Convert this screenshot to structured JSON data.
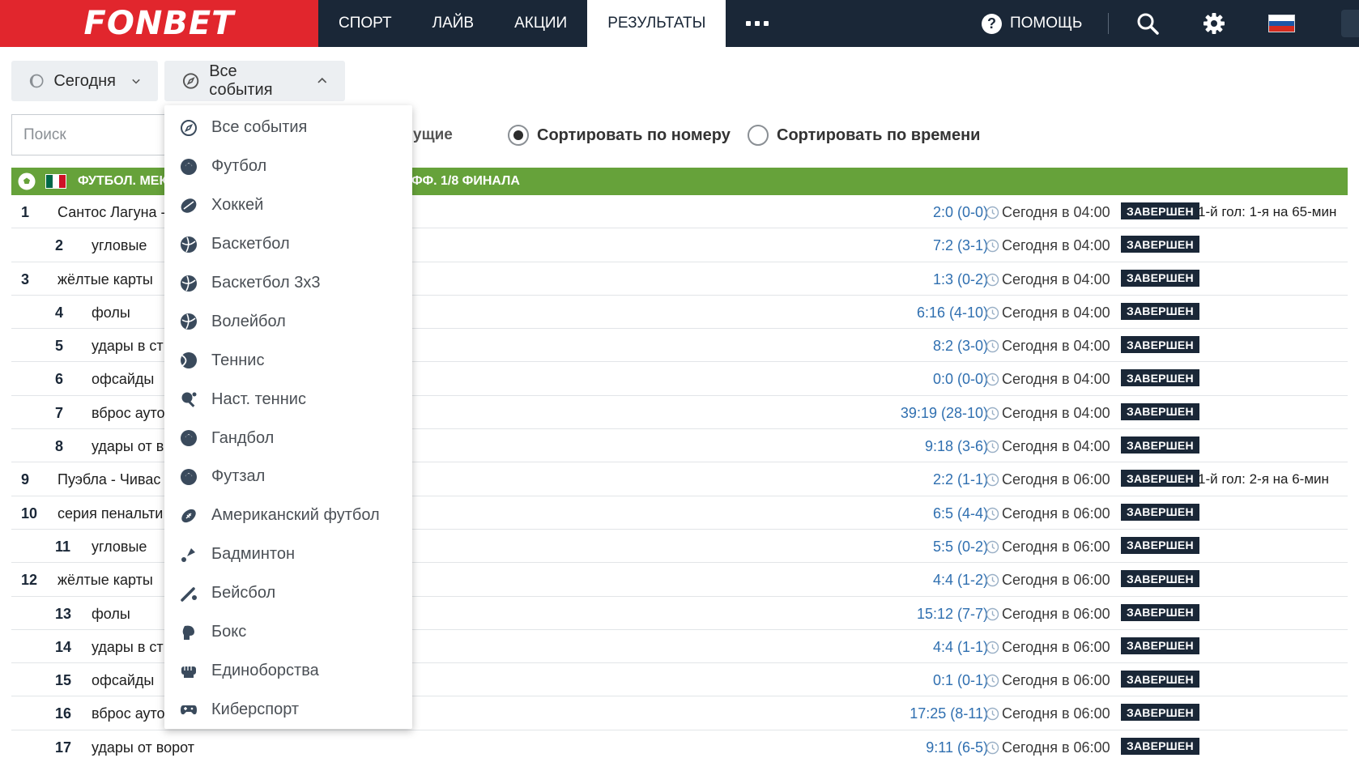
{
  "brand": {
    "logo": "FONBET"
  },
  "nav": {
    "items": [
      {
        "label": "СПОРТ",
        "active": false
      },
      {
        "label": "ЛАЙВ",
        "active": false
      },
      {
        "label": "АКЦИИ",
        "active": false
      },
      {
        "label": "РЕЗУЛЬТАТЫ",
        "active": true
      }
    ],
    "help_label": "ПОМОЩЬ"
  },
  "filters": {
    "date_label": "Сегодня",
    "events_label": "Все события",
    "search_placeholder": "Поиск",
    "partial_label": "ущие",
    "sort_by_number": "Сортировать по номеру",
    "sort_by_time": "Сортировать по времени",
    "sort_selected": "number"
  },
  "league": {
    "name_left": "ФУТБОЛ. МЕК",
    "name_right": "ФФ. 1/8 ФИНАЛА"
  },
  "rows": [
    {
      "num": "1",
      "indent": false,
      "name": "Сантос Лагуна -",
      "score": "2:0 (0-0)",
      "time": "Сегодня в 04:00",
      "status": "ЗАВЕРШЕН",
      "note": "1-й гол: 1-я на 65-мин"
    },
    {
      "num": "2",
      "indent": true,
      "name": "угловые",
      "score": "7:2 (3-1)",
      "time": "Сегодня в 04:00",
      "status": "ЗАВЕРШЕН",
      "note": ""
    },
    {
      "num": "3",
      "indent": false,
      "name": "жёлтые карты",
      "score": "1:3 (0-2)",
      "time": "Сегодня в 04:00",
      "status": "ЗАВЕРШЕН",
      "note": ""
    },
    {
      "num": "4",
      "indent": true,
      "name": "фолы",
      "score": "6:16 (4-10)",
      "time": "Сегодня в 04:00",
      "status": "ЗАВЕРШЕН",
      "note": ""
    },
    {
      "num": "5",
      "indent": true,
      "name": "удары в ст",
      "score": "8:2 (3-0)",
      "time": "Сегодня в 04:00",
      "status": "ЗАВЕРШЕН",
      "note": ""
    },
    {
      "num": "6",
      "indent": true,
      "name": "офсайды",
      "score": "0:0 (0-0)",
      "time": "Сегодня в 04:00",
      "status": "ЗАВЕРШЕН",
      "note": ""
    },
    {
      "num": "7",
      "indent": true,
      "name": "вброс ауто",
      "score": "39:19 (28-10)",
      "time": "Сегодня в 04:00",
      "status": "ЗАВЕРШЕН",
      "note": ""
    },
    {
      "num": "8",
      "indent": true,
      "name": "удары от в",
      "score": "9:18 (3-6)",
      "time": "Сегодня в 04:00",
      "status": "ЗАВЕРШЕН",
      "note": ""
    },
    {
      "num": "9",
      "indent": false,
      "name": "Пуэбла - Чивас",
      "score": "2:2 (1-1)",
      "time": "Сегодня в 06:00",
      "status": "ЗАВЕРШЕН",
      "note": "1-й гол: 2-я на 6-мин"
    },
    {
      "num": "10",
      "indent": false,
      "name": "серия пенальти",
      "score": "6:5 (4-4)",
      "time": "Сегодня в 06:00",
      "status": "ЗАВЕРШЕН",
      "note": ""
    },
    {
      "num": "11",
      "indent": true,
      "name": "угловые",
      "score": "5:5 (0-2)",
      "time": "Сегодня в 06:00",
      "status": "ЗАВЕРШЕН",
      "note": ""
    },
    {
      "num": "12",
      "indent": false,
      "name": "жёлтые карты",
      "score": "4:4 (1-2)",
      "time": "Сегодня в 06:00",
      "status": "ЗАВЕРШЕН",
      "note": ""
    },
    {
      "num": "13",
      "indent": true,
      "name": "фолы",
      "score": "15:12 (7-7)",
      "time": "Сегодня в 06:00",
      "status": "ЗАВЕРШЕН",
      "note": ""
    },
    {
      "num": "14",
      "indent": true,
      "name": "удары в ст",
      "score": "4:4 (1-1)",
      "time": "Сегодня в 06:00",
      "status": "ЗАВЕРШЕН",
      "note": ""
    },
    {
      "num": "15",
      "indent": true,
      "name": "офсайды",
      "score": "0:1 (0-1)",
      "time": "Сегодня в 06:00",
      "status": "ЗАВЕРШЕН",
      "note": ""
    },
    {
      "num": "16",
      "indent": true,
      "name": "вброс ауто",
      "score": "17:25 (8-11)",
      "time": "Сегодня в 06:00",
      "status": "ЗАВЕРШЕН",
      "note": ""
    },
    {
      "num": "17",
      "indent": true,
      "name": "удары от ворот",
      "score": "9:11 (6-5)",
      "time": "Сегодня в 06:00",
      "status": "ЗАВЕРШЕН",
      "note": ""
    }
  ],
  "dropdown": {
    "items": [
      {
        "label": "Все события",
        "icon": "compass-icon"
      },
      {
        "label": "Футбол",
        "icon": "football-icon"
      },
      {
        "label": "Хоккей",
        "icon": "hockey-icon"
      },
      {
        "label": "Баскетбол",
        "icon": "basketball-icon"
      },
      {
        "label": "Баскетбол 3x3",
        "icon": "basketball-3x3-icon"
      },
      {
        "label": "Волейбол",
        "icon": "volleyball-icon"
      },
      {
        "label": "Теннис",
        "icon": "tennis-icon"
      },
      {
        "label": "Наст. теннис",
        "icon": "table-tennis-icon"
      },
      {
        "label": "Гандбол",
        "icon": "handball-icon"
      },
      {
        "label": "Футзал",
        "icon": "futsal-icon"
      },
      {
        "label": "Американский футбол",
        "icon": "american-football-icon"
      },
      {
        "label": "Бадминтон",
        "icon": "badminton-icon"
      },
      {
        "label": "Бейсбол",
        "icon": "baseball-icon"
      },
      {
        "label": "Бокс",
        "icon": "boxing-icon"
      },
      {
        "label": "Единоборства",
        "icon": "martial-arts-icon"
      },
      {
        "label": "Киберспорт",
        "icon": "esports-icon"
      }
    ]
  },
  "colors": {
    "topbar": "#1a2737",
    "logo_bg": "#e1262d",
    "league_bar": "#66a23a",
    "score": "#2f6fb0",
    "status_bg": "#1a2737"
  }
}
